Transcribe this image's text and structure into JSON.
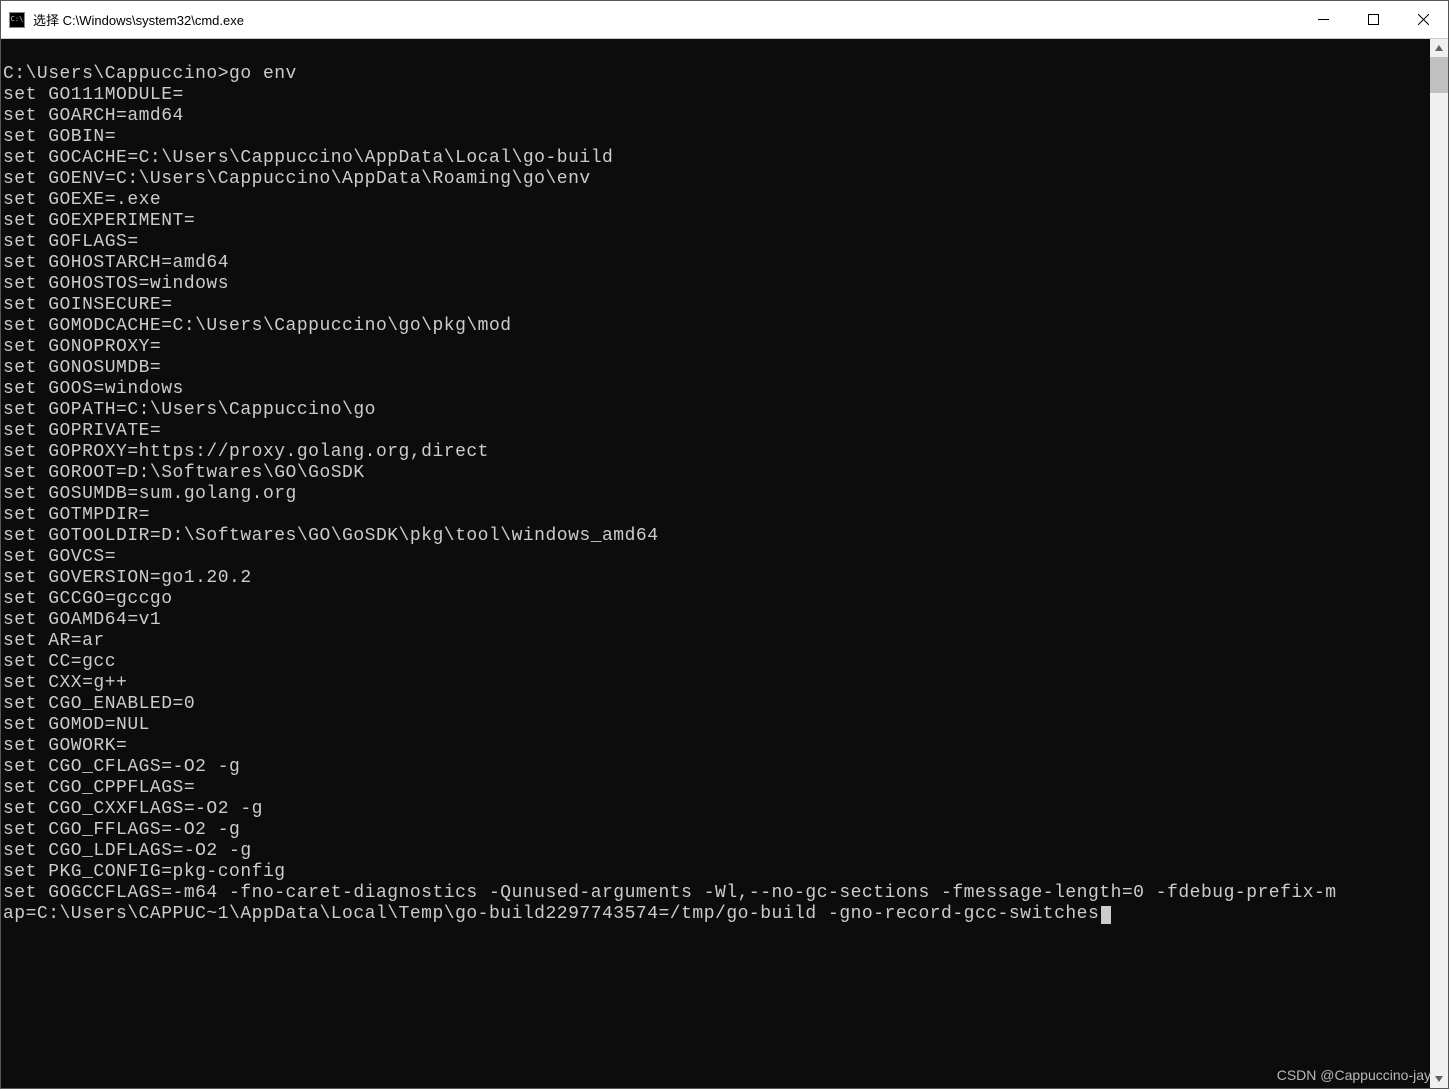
{
  "window": {
    "title": "选择 C:\\Windows\\system32\\cmd.exe"
  },
  "terminal": {
    "prompt_path": "C:\\Users\\Cappuccino>",
    "command": "go env",
    "lines": [
      "set GO111MODULE=",
      "set GOARCH=amd64",
      "set GOBIN=",
      "set GOCACHE=C:\\Users\\Cappuccino\\AppData\\Local\\go-build",
      "set GOENV=C:\\Users\\Cappuccino\\AppData\\Roaming\\go\\env",
      "set GOEXE=.exe",
      "set GOEXPERIMENT=",
      "set GOFLAGS=",
      "set GOHOSTARCH=amd64",
      "set GOHOSTOS=windows",
      "set GOINSECURE=",
      "set GOMODCACHE=C:\\Users\\Cappuccino\\go\\pkg\\mod",
      "set GONOPROXY=",
      "set GONOSUMDB=",
      "set GOOS=windows",
      "set GOPATH=C:\\Users\\Cappuccino\\go",
      "set GOPRIVATE=",
      "set GOPROXY=https://proxy.golang.org,direct",
      "set GOROOT=D:\\Softwares\\GO\\GoSDK",
      "set GOSUMDB=sum.golang.org",
      "set GOTMPDIR=",
      "set GOTOOLDIR=D:\\Softwares\\GO\\GoSDK\\pkg\\tool\\windows_amd64",
      "set GOVCS=",
      "set GOVERSION=go1.20.2",
      "set GCCGO=gccgo",
      "set GOAMD64=v1",
      "set AR=ar",
      "set CC=gcc",
      "set CXX=g++",
      "set CGO_ENABLED=0",
      "set GOMOD=NUL",
      "set GOWORK=",
      "set CGO_CFLAGS=-O2 -g",
      "set CGO_CPPFLAGS=",
      "set CGO_CXXFLAGS=-O2 -g",
      "set CGO_FFLAGS=-O2 -g",
      "set CGO_LDFLAGS=-O2 -g",
      "set PKG_CONFIG=pkg-config"
    ],
    "last_line_1": "set GOGCCFLAGS=-m64 -fno-caret-diagnostics -Qunused-arguments -Wl,--no-gc-sections -fmessage-length=0 -fdebug-prefix-m",
    "last_line_2": "ap=C:\\Users\\CAPPUC~1\\AppData\\Local\\Temp\\go-build2297743574=/tmp/go-build -gno-record-gcc-switches"
  },
  "watermark": "CSDN @Cappuccino-jay"
}
